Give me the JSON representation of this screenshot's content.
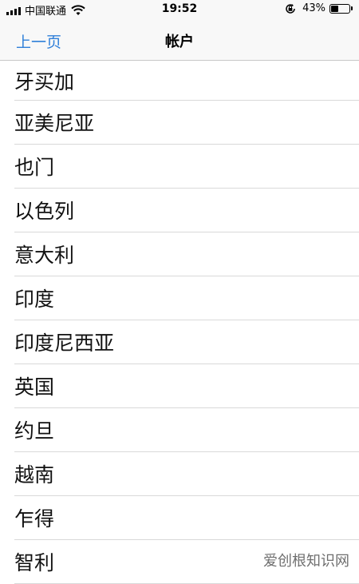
{
  "status_bar": {
    "carrier": "中国联通",
    "time": "19:52",
    "battery_percent": "43%",
    "battery_level": 0.43
  },
  "nav": {
    "back_label": "上一页",
    "title": "帐户"
  },
  "list": {
    "items": [
      "牙买加",
      "亚美尼亚",
      "也门",
      "以色列",
      "意大利",
      "印度",
      "印度尼西亚",
      "英国",
      "约旦",
      "越南",
      "乍得",
      "智利"
    ]
  },
  "watermark": "爱创根知识网",
  "colors": {
    "accent": "#2f7fd9",
    "bar_background": "#f8f8f8",
    "separator": "#d9d9d9"
  }
}
